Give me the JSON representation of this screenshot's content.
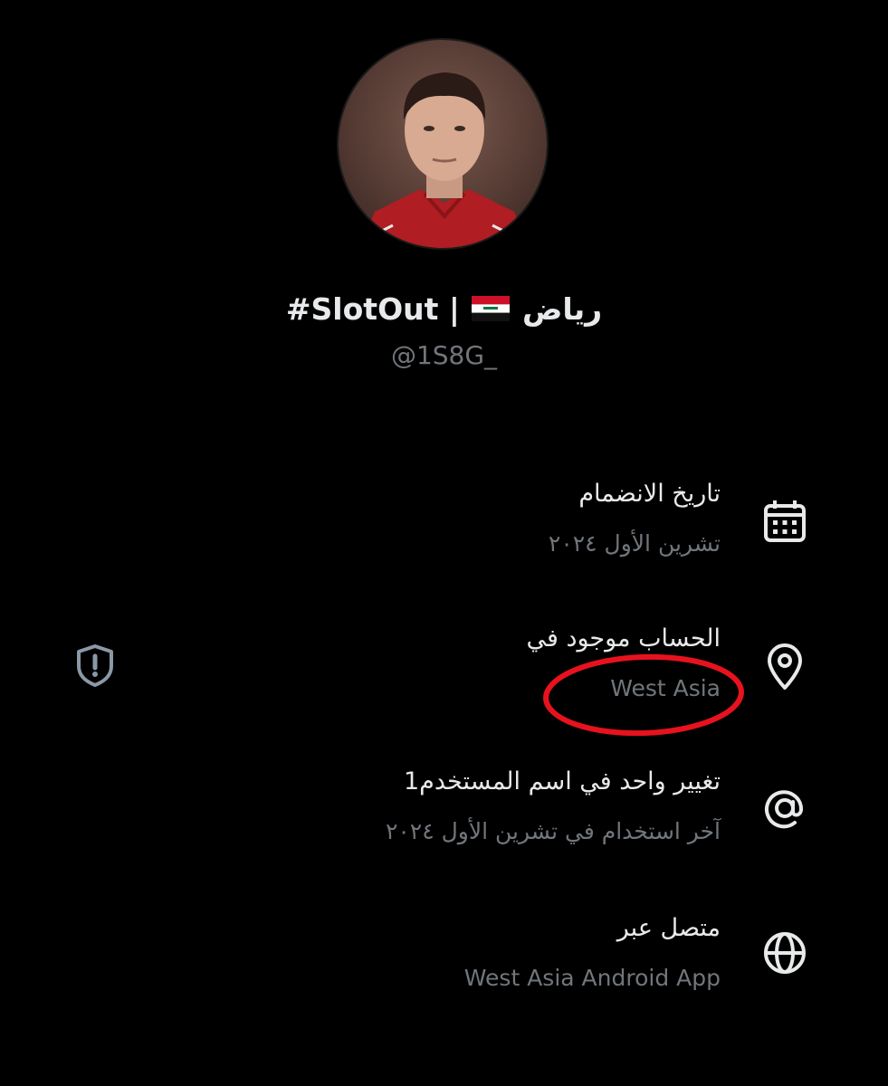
{
  "profile": {
    "display_name_prefix": "#SlotOut |",
    "display_name_suffix": "رياض",
    "flag_icon": "iraq-flag-icon",
    "handle": "@1S8G_"
  },
  "info_rows": [
    {
      "icon": "calendar-icon",
      "title": "تاريخ الانضمام",
      "subtitle": "تشرين الأول ٢٠٢٤"
    },
    {
      "icon": "location-pin-icon",
      "title": "الحساب موجود في",
      "subtitle": "West Asia"
    },
    {
      "icon": "at-sign-icon",
      "title": "تغيير واحد في اسم المستخدم1",
      "subtitle": "آخر استخدام في تشرين الأول ٢٠٢٤"
    },
    {
      "icon": "globe-icon",
      "title": "متصل عبر",
      "subtitle": "West Asia Android App"
    }
  ],
  "colors": {
    "background": "#000000",
    "primary_text": "#e7e9ea",
    "secondary_text": "#71767b",
    "annotation": "#e8121e"
  }
}
